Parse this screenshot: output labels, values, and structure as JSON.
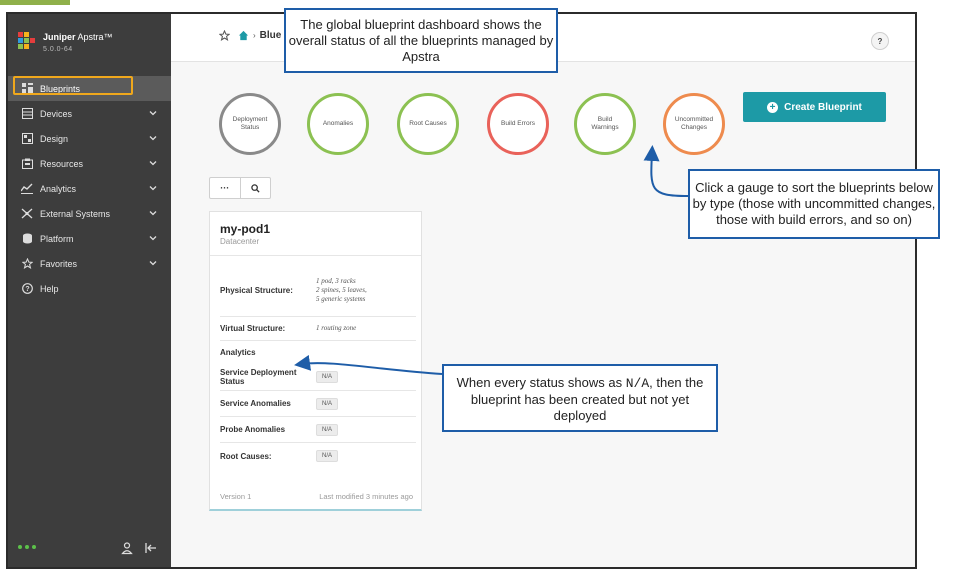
{
  "app": {
    "name_bold": "Juniper",
    "name_rest": " Apstra™",
    "version": "5.0.0-64"
  },
  "sidebar": {
    "items": [
      {
        "label": "Blueprints",
        "icon": "blueprints-icon",
        "active": true,
        "has_chevron": false
      },
      {
        "label": "Devices",
        "icon": "devices-icon",
        "has_chevron": true
      },
      {
        "label": "Design",
        "icon": "design-icon",
        "has_chevron": true
      },
      {
        "label": "Resources",
        "icon": "resources-icon",
        "has_chevron": true
      },
      {
        "label": "Analytics",
        "icon": "analytics-icon",
        "has_chevron": true
      },
      {
        "label": "External Systems",
        "icon": "external-systems-icon",
        "has_chevron": true
      },
      {
        "label": "Platform",
        "icon": "platform-icon",
        "has_chevron": true
      },
      {
        "label": "Favorites",
        "icon": "star-icon",
        "has_chevron": true
      },
      {
        "label": "Help",
        "icon": "help-circle-icon",
        "has_chevron": false
      }
    ]
  },
  "header": {
    "breadcrumb_current": "Blue",
    "help_label": "?"
  },
  "gauges": [
    {
      "label": "Deployment Status",
      "color": "#8a8a8a"
    },
    {
      "label": "Anomalies",
      "color": "#8cc152"
    },
    {
      "label": "Root Causes",
      "color": "#8cc152"
    },
    {
      "label": "Build Errors",
      "color": "#e9625a"
    },
    {
      "label": "Build Warnings",
      "color": "#8cc152"
    },
    {
      "label": "Uncommitted Changes",
      "color": "#ee8b4e"
    }
  ],
  "create_button": {
    "label": "Create Blueprint",
    "color": "#1d9aa6"
  },
  "tools": {
    "more": "···",
    "search_icon": "search-icon"
  },
  "card": {
    "name": "my-pod1",
    "type": "Datacenter",
    "rows": [
      {
        "key": "Physical Structure:",
        "lines": [
          "1 pod, 3 racks",
          "2 spines, 5 leaves,",
          "5 generic systems"
        ]
      },
      {
        "key": "Virtual Structure:",
        "lines": [
          "1 routing zone"
        ]
      },
      {
        "key": "Analytics",
        "lines": []
      },
      {
        "key": "Service Deployment Status",
        "badge": "N/A"
      },
      {
        "key": "Service Anomalies",
        "badge": "N/A"
      },
      {
        "key": "Probe Anomalies",
        "badge": "N/A"
      },
      {
        "key": "Root Causes:",
        "badge": "N/A"
      }
    ],
    "version": "Version 1",
    "modified": "Last modified 3 minutes ago"
  },
  "callouts": {
    "top": "The global blueprint dashboard shows the overall status of all the blueprints managed by Apstra",
    "right": "Click a gauge to sort the blueprints below by type (those with uncommitted changes, those with build errors, and so on)",
    "middle_pre": "When every status shows as ",
    "middle_code": "N/A",
    "middle_post": ", then the blueprint has been created but not yet deployed",
    "border_color": "#1e5da8"
  }
}
